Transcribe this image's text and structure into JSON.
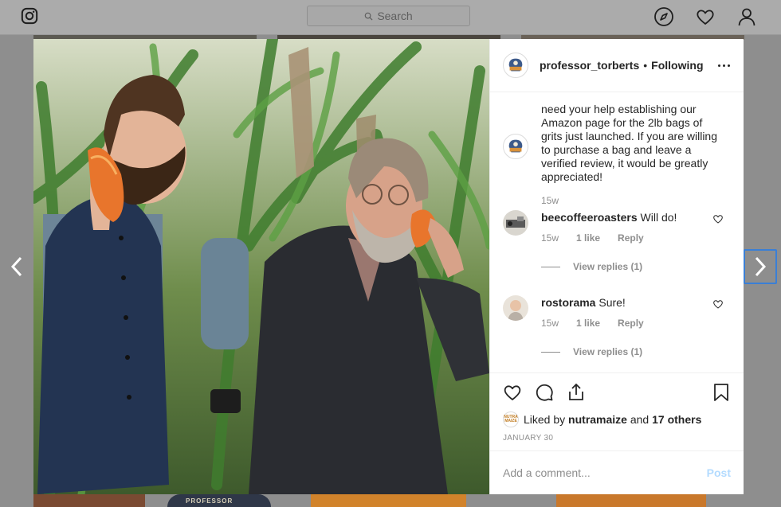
{
  "header": {
    "search_placeholder": "Search",
    "icons": [
      "instagram-logo-icon",
      "search-icon",
      "compass-icon",
      "heart-icon",
      "profile-icon"
    ]
  },
  "post": {
    "username": "professor_torberts",
    "separator": "•",
    "follow_state": "Following",
    "caption": "need your help establishing our Amazon page for the 2lb bags of grits just launched. If you are willing to purchase a bag and leave a verified review, it would be greatly appreciated!",
    "caption_time": "15w",
    "comments": [
      {
        "username": "beecoffeeroasters",
        "text": "Will do!",
        "time": "15w",
        "likes": "1 like",
        "reply": "Reply",
        "view_replies": "View replies (1)"
      },
      {
        "username": "rostorama",
        "text": "Sure!",
        "time": "15w",
        "likes": "1 like",
        "reply": "Reply",
        "view_replies": "View replies (1)"
      }
    ],
    "liked_by_prefix": "Liked by",
    "liked_by_user": "nutramaize",
    "liked_by_and": "and",
    "liked_by_others": "17 others",
    "liker_logo_text": "NUTRA MAIZE",
    "date": "JANUARY 30",
    "add_comment_placeholder": "Add a comment...",
    "post_label": "Post"
  },
  "background": {
    "peek_text": "PROFESSOR"
  },
  "colors": {
    "overlay": "#8e8e8e",
    "text": "#262626",
    "secondary": "#8e8e8e",
    "post_button_disabled": "#b3dbff",
    "focus_ring": "#3a7fd6"
  }
}
